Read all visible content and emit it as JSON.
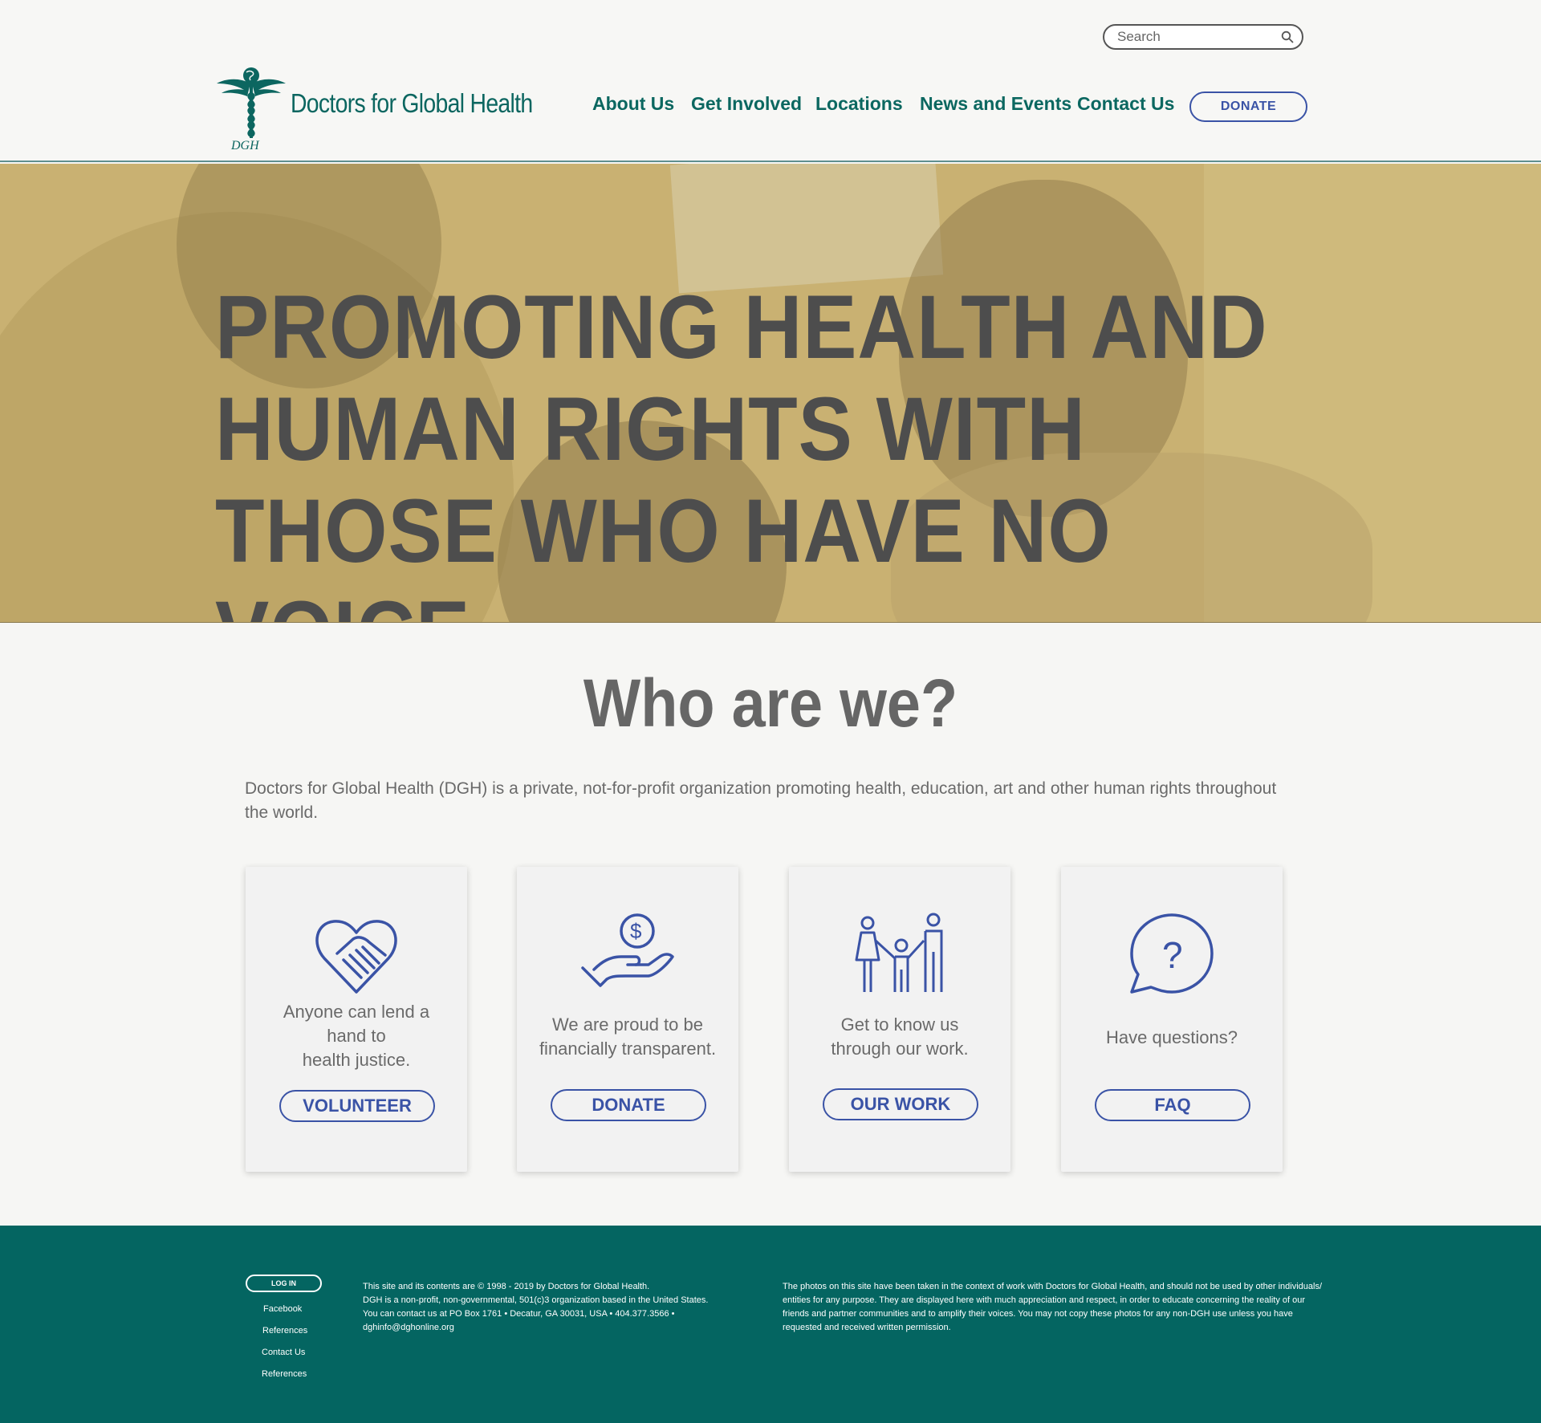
{
  "header": {
    "search_placeholder": "Search",
    "brand_name": "Doctors for Global Health",
    "logo_text": "DGH",
    "nav": [
      "About Us",
      "Get Involved",
      "Locations",
      "News and Events",
      "Contact Us"
    ],
    "donate_label": "DONATE"
  },
  "hero": {
    "title": "PROMOTING HEALTH AND HUMAN RIGHTS WITH THOSE WHO HAVE NO VOICE"
  },
  "who": {
    "title": "Who are we?",
    "text": "Doctors for Global Health (DGH) is a private, not-for-profit organization promoting health, education, art and other human rights throughout the world."
  },
  "cards": [
    {
      "icon": "heart-handshake-icon",
      "text": [
        "Anyone can lend a",
        "hand to",
        "health justice."
      ],
      "button": "VOLUNTEER"
    },
    {
      "icon": "hand-coin-icon",
      "text": [
        "We are proud to be",
        "financially transparent."
      ],
      "button": "DONATE"
    },
    {
      "icon": "family-icon",
      "text": [
        "Get to know us",
        "through our work."
      ],
      "button": "OUR WORK"
    },
    {
      "icon": "question-bubble-icon",
      "text": [
        "Have questions?"
      ],
      "button": "FAQ"
    }
  ],
  "footer": {
    "login_label": "LOG IN",
    "links": [
      "Facebook",
      "References",
      "Contact Us",
      "References"
    ],
    "copyright_lines": [
      "This site and its contents are © 1998 - 2019 by Doctors for Global Health.",
      "DGH is a non-profit, non-governmental, 501(c)3 organization based in the United States.",
      "You can contact us at PO Box 1761 • Decatur, GA 30031, USA • 404.377.3566 •",
      "dghinfo@dghonline.org"
    ],
    "photo_notice_lines": [
      "The photos on this site have been taken in the context of work with Doctors for Global Health, and should not be used by other individuals/",
      "entities for any purpose. They are displayed here with much appreciation and respect, in order to educate concerning the reality of our",
      "friends and partner communities and to amplify their voices. You may not copy these photos for any non-DGH use unless you have",
      "requested and received written permission."
    ]
  },
  "colors": {
    "teal": "#046561",
    "nav_teal": "#0b6760",
    "blue": "#3a53a6",
    "hero_gold": "#c9b172",
    "hero_text": "#4d4d4d"
  }
}
